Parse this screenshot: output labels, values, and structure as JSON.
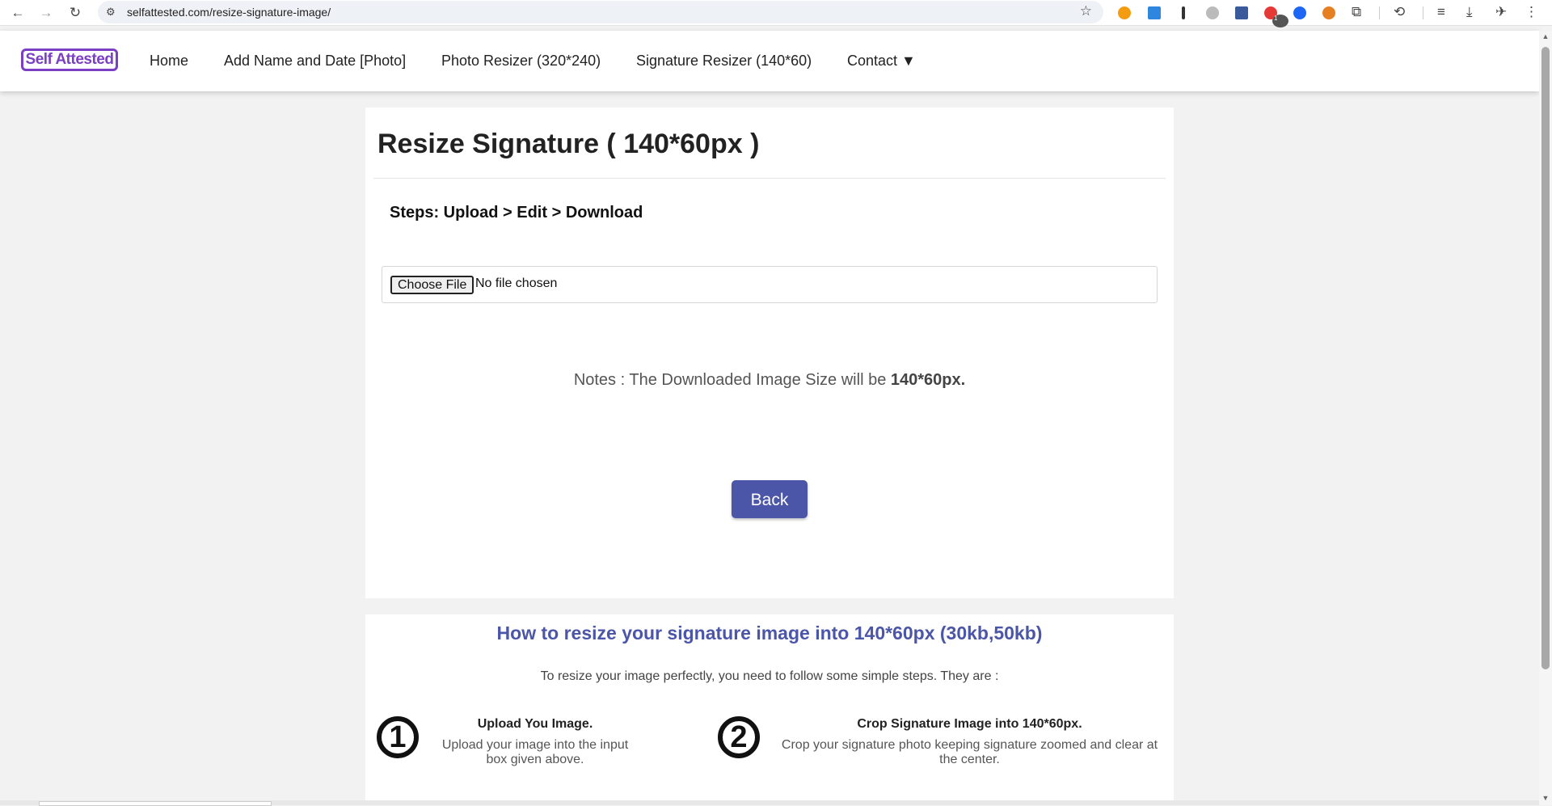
{
  "browser": {
    "url": "selfattested.com/resize-signature-image/",
    "extension_badge": "1"
  },
  "header": {
    "logo_text": "Self Attested",
    "nav": [
      {
        "label": "Home"
      },
      {
        "label": "Add Name and Date [Photo]"
      },
      {
        "label": "Photo Resizer (320*240)"
      },
      {
        "label": "Signature Resizer (140*60)"
      },
      {
        "label": "Contact ▼"
      }
    ]
  },
  "main": {
    "title": "Resize Signature ( 140*60px )",
    "steps": "Steps: Upload > Edit > Download",
    "file_button": "Choose File",
    "file_status": "No file chosen",
    "notes_prefix": "Notes : The Downloaded Image Size will be ",
    "notes_bold": "140*60px.",
    "back_label": "Back"
  },
  "how": {
    "title": "How to resize your signature image into 140*60px (30kb,50kb)",
    "subtitle": "To resize your image perfectly, you need to follow some simple steps. They are :",
    "steps": [
      {
        "num": "1",
        "title": "Upload You Image.",
        "desc": "Upload your image into the input box given above."
      },
      {
        "num": "2",
        "title": "Crop Signature Image into 140*60px.",
        "desc": "Crop your signature photo keeping signature zoomed and clear at the center."
      }
    ]
  },
  "colors": {
    "accent": "#4b56a8",
    "logo": "#7b3fc4"
  }
}
